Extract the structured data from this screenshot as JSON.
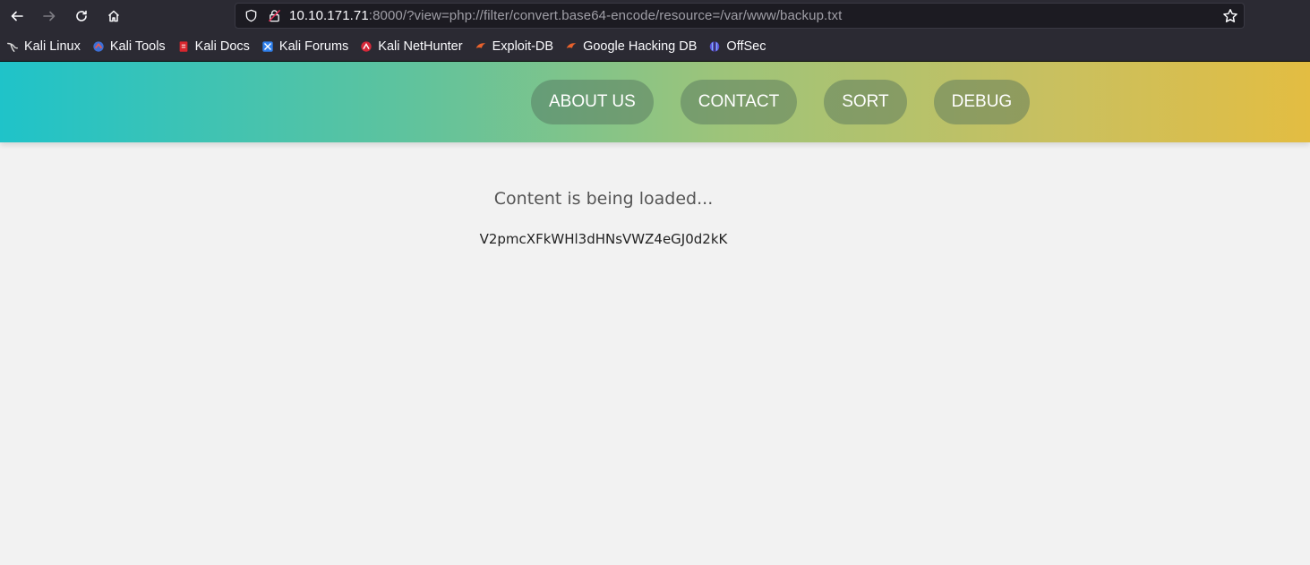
{
  "browser": {
    "url_host": "10.10.171.71",
    "url_rest": ":8000/?view=php://filter/convert.base64-encode/resource=/var/www/backup.txt",
    "bookmarks": [
      {
        "label": "Kali Linux",
        "icon": "kali-dragon-icon"
      },
      {
        "label": "Kali Tools",
        "icon": "kali-tools-icon"
      },
      {
        "label": "Kali Docs",
        "icon": "kali-docs-icon"
      },
      {
        "label": "Kali Forums",
        "icon": "kali-forums-icon"
      },
      {
        "label": "Kali NetHunter",
        "icon": "nethunter-icon"
      },
      {
        "label": "Exploit-DB",
        "icon": "exploit-db-icon"
      },
      {
        "label": "Google Hacking DB",
        "icon": "ghdb-icon"
      },
      {
        "label": "OffSec",
        "icon": "offsec-icon"
      }
    ]
  },
  "header": {
    "menu": [
      {
        "label": "ABOUT US"
      },
      {
        "label": "CONTACT"
      },
      {
        "label": "SORT"
      },
      {
        "label": "DEBUG"
      }
    ]
  },
  "main": {
    "loading_text": "Content is being loaded...",
    "output": "V2pmcXFkWHl3dHNsVWZ4eGJ0d2kK"
  }
}
